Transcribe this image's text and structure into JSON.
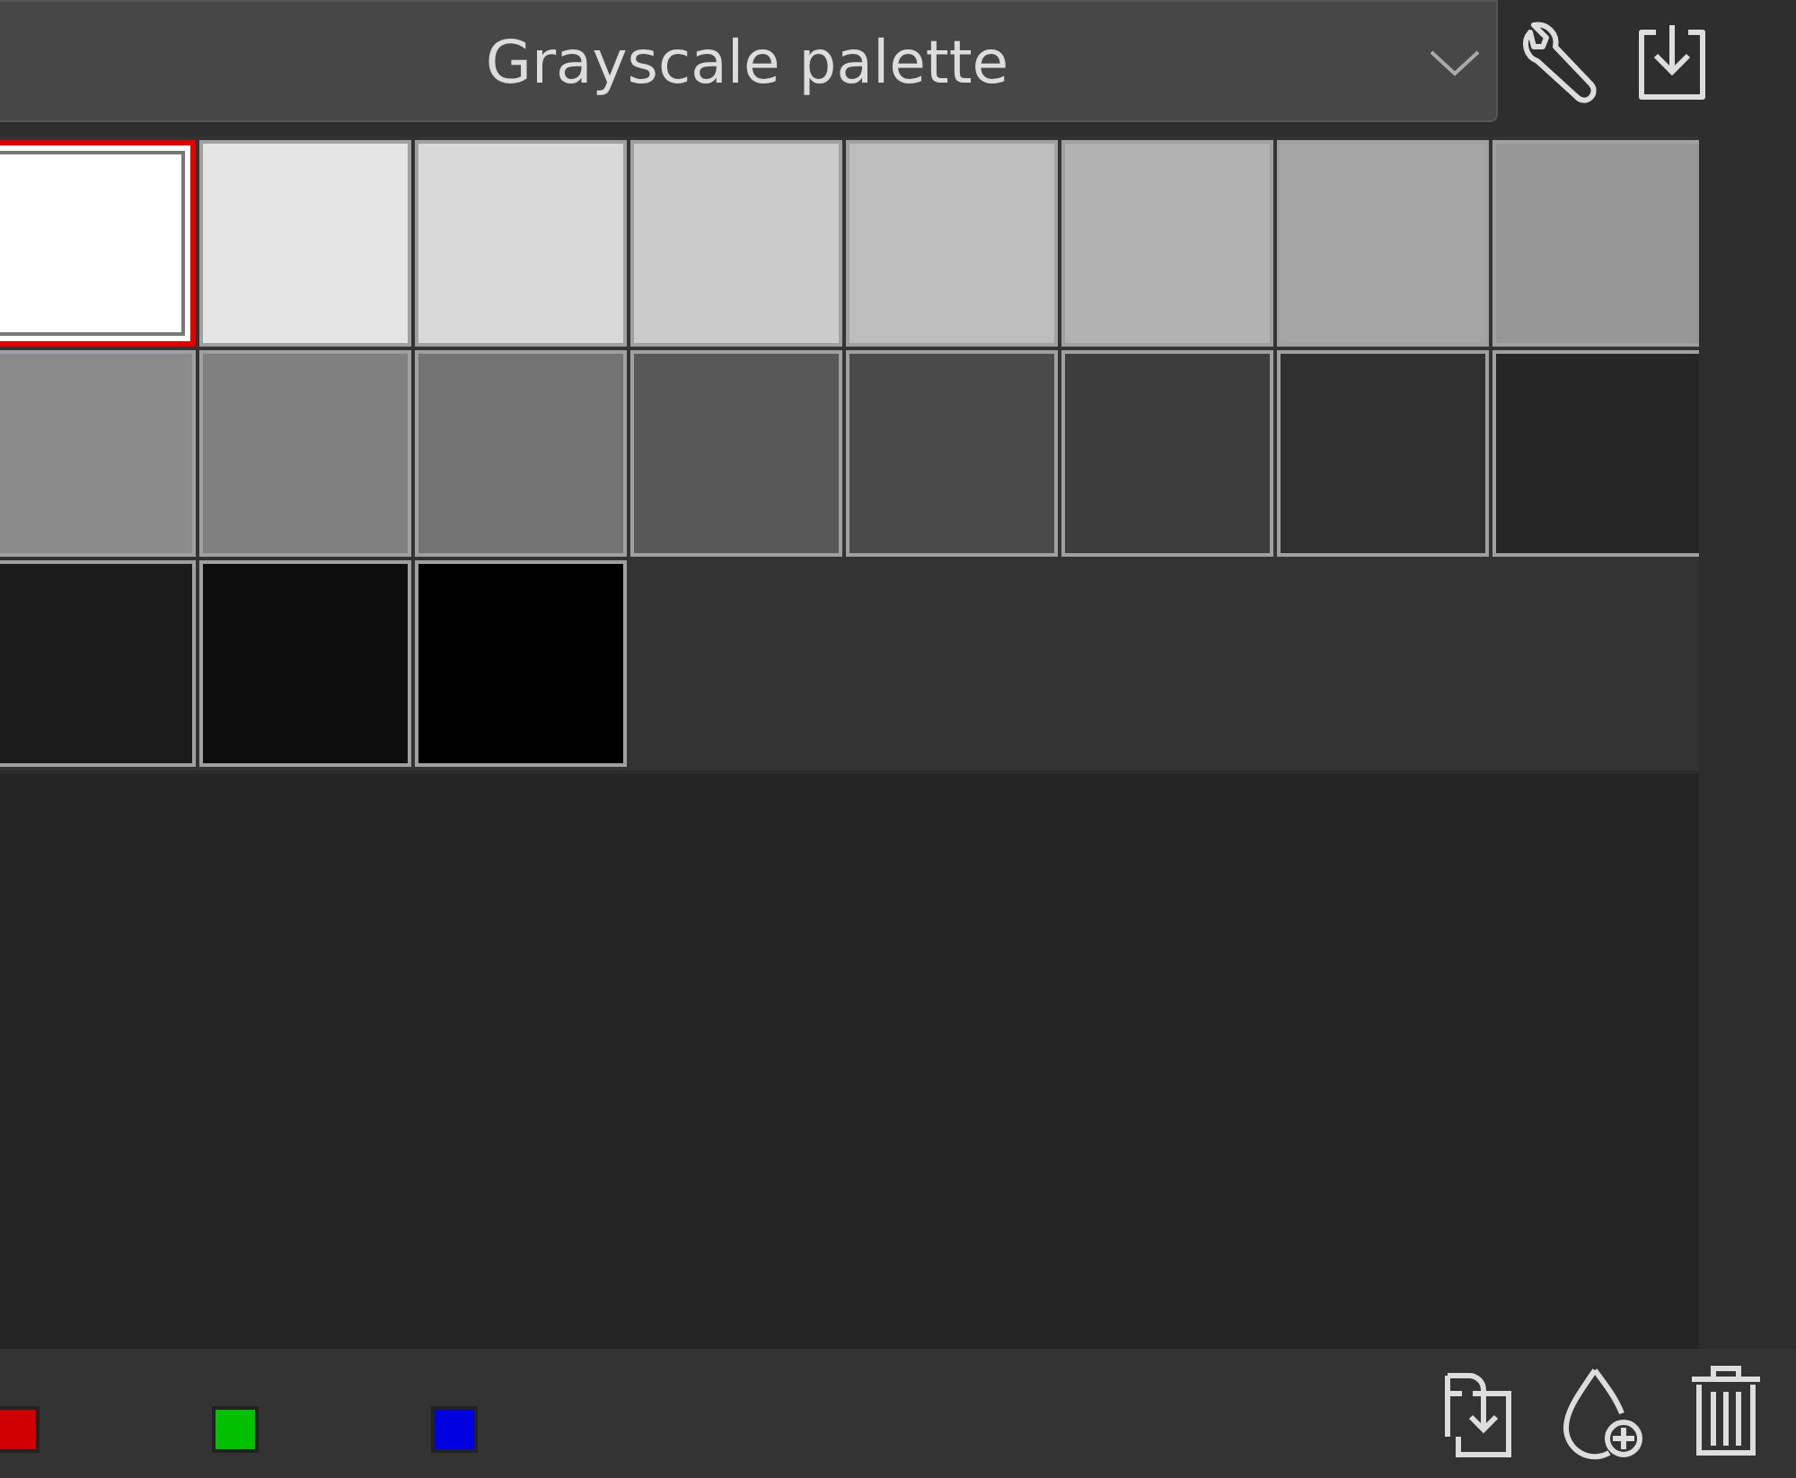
{
  "palette_selector": {
    "value": "Grayscale palette"
  },
  "swatches": [
    {
      "color": "#ffffff",
      "selected": true
    },
    {
      "color": "#e4e4e4",
      "selected": false
    },
    {
      "color": "#d9d9d9",
      "selected": false
    },
    {
      "color": "#cbcbcb",
      "selected": false
    },
    {
      "color": "#bdbdbd",
      "selected": false
    },
    {
      "color": "#b2b2b2",
      "selected": false
    },
    {
      "color": "#a5a5a5",
      "selected": false
    },
    {
      "color": "#969696",
      "selected": false
    },
    {
      "color": "#8b8b8b",
      "selected": false
    },
    {
      "color": "#808080",
      "selected": false
    },
    {
      "color": "#737373",
      "selected": false
    },
    {
      "color": "#585858",
      "selected": false
    },
    {
      "color": "#4a4a4a",
      "selected": false
    },
    {
      "color": "#3d3d3d",
      "selected": false
    },
    {
      "color": "#303030",
      "selected": false
    },
    {
      "color": "#262626",
      "selected": false
    },
    {
      "color": "#1b1b1b",
      "selected": false
    },
    {
      "color": "#0e0e0e",
      "selected": false
    },
    {
      "color": "#000000",
      "selected": false
    }
  ],
  "color_slots": [
    {
      "color": "#d00000"
    },
    {
      "color": "#00c000"
    },
    {
      "color": "#0000e0"
    }
  ]
}
